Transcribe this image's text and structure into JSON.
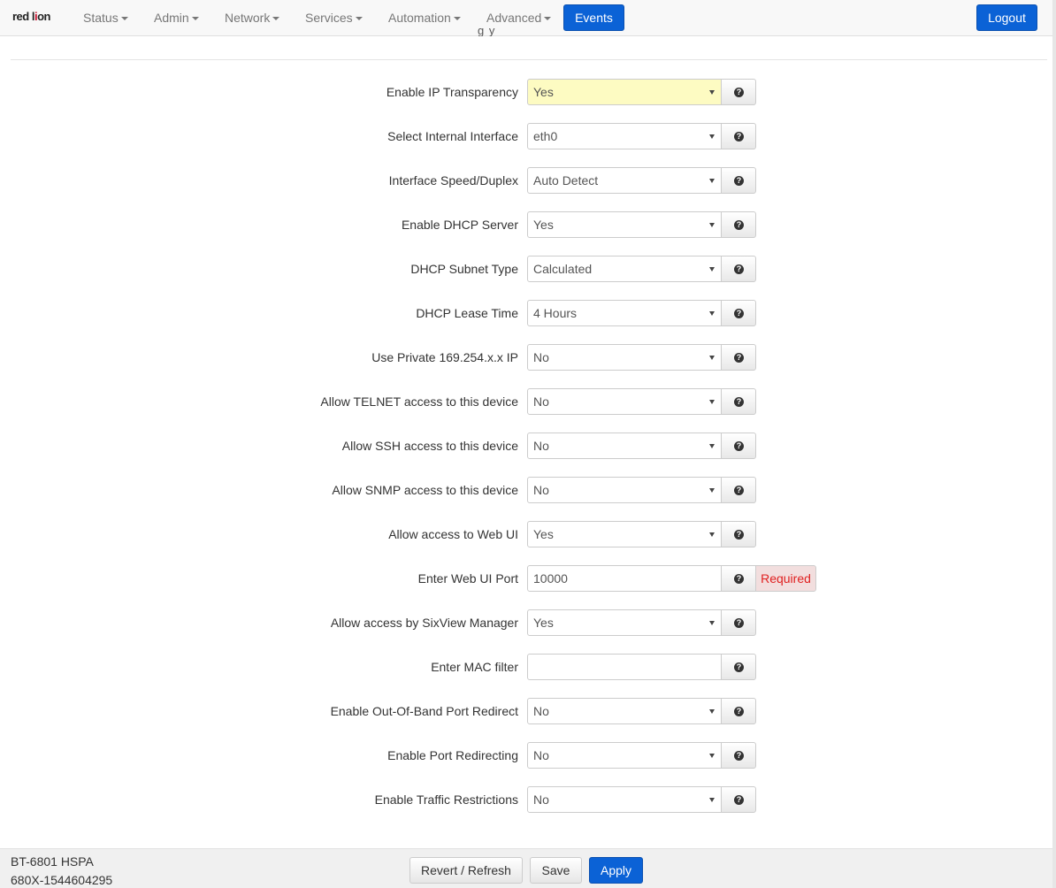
{
  "navbar": {
    "logo_text": "red lion",
    "menus": [
      {
        "label": "Status"
      },
      {
        "label": "Admin"
      },
      {
        "label": "Network"
      },
      {
        "label": "Services"
      },
      {
        "label": "Automation"
      },
      {
        "label": "Advanced"
      }
    ],
    "events_label": "Events",
    "logout_label": "Logout",
    "accent_color": "#0b62d6"
  },
  "page": {
    "subtitle_fragment": "g   y"
  },
  "form": {
    "help_icon": "question-circle-icon",
    "fields": [
      {
        "label": "Enable IP Transparency",
        "type": "select",
        "value": "Yes",
        "highlight": true
      },
      {
        "label": "Select Internal Interface",
        "type": "select",
        "value": "eth0"
      },
      {
        "label": "Interface Speed/Duplex",
        "type": "select",
        "value": "Auto Detect"
      },
      {
        "label": "Enable DHCP Server",
        "type": "select",
        "value": "Yes"
      },
      {
        "label": "DHCP Subnet Type",
        "type": "select",
        "value": "Calculated"
      },
      {
        "label": "DHCP Lease Time",
        "type": "select",
        "value": "4 Hours"
      },
      {
        "label": "Use Private 169.254.x.x IP",
        "type": "select",
        "value": "No"
      },
      {
        "label": "Allow TELNET access to this device",
        "type": "select",
        "value": "No"
      },
      {
        "label": "Allow SSH access to this device",
        "type": "select",
        "value": "No"
      },
      {
        "label": "Allow SNMP access to this device",
        "type": "select",
        "value": "No"
      },
      {
        "label": "Allow access to Web UI",
        "type": "select",
        "value": "Yes"
      },
      {
        "label": "Enter Web UI Port",
        "type": "text",
        "value": "10000",
        "addon": "Required"
      },
      {
        "label": "Allow access by SixView Manager",
        "type": "select",
        "value": "Yes"
      },
      {
        "label": "Enter MAC filter",
        "type": "text",
        "value": ""
      },
      {
        "label": "Enable Out-Of-Band Port Redirect",
        "type": "select",
        "value": "No"
      },
      {
        "label": "Enable Port Redirecting",
        "type": "select",
        "value": "No"
      },
      {
        "label": "Enable Traffic Restrictions",
        "type": "select",
        "value": "No"
      }
    ]
  },
  "footer": {
    "model": "BT-6801 HSPA",
    "serial": "680X-1544604295",
    "revert_label": "Revert / Refresh",
    "save_label": "Save",
    "apply_label": "Apply"
  }
}
